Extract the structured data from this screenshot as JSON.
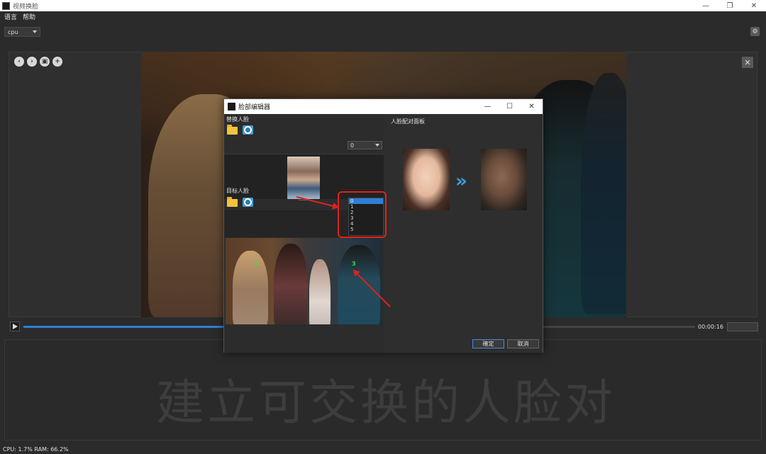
{
  "window": {
    "title": "视频换脸",
    "minimize": "—",
    "maximize": "❐",
    "close": "✕"
  },
  "menu": [
    "语言",
    "帮助"
  ],
  "device_select": {
    "value": "cpu"
  },
  "timecode": "00:00:16",
  "playback_progress": 0.3,
  "watermark": "建立可交换的人脸对",
  "status": "CPU: 1.7% RAM: 66.2%",
  "dialog": {
    "title": "脸部编辑器",
    "controls": {
      "minimize": "—",
      "maximize": "☐",
      "close": "✕"
    },
    "replace_label": "替换人脸",
    "replace_combo_value": "0",
    "target_label": "目标人脸",
    "dropdown_options": [
      "0",
      "1",
      "2",
      "3",
      "4",
      "5"
    ],
    "dropdown_selected": "0",
    "face_numbers": [
      "3",
      "3"
    ],
    "pair_panel_title": "人脸配对面板",
    "arrow_glyph": "»",
    "ok": "確定",
    "cancel": "取消"
  },
  "nav_icons": [
    "back-icon",
    "forward-icon",
    "save-icon",
    "add-icon"
  ],
  "accent_color": "#2f7fd6",
  "annotation_color": "#e02020"
}
